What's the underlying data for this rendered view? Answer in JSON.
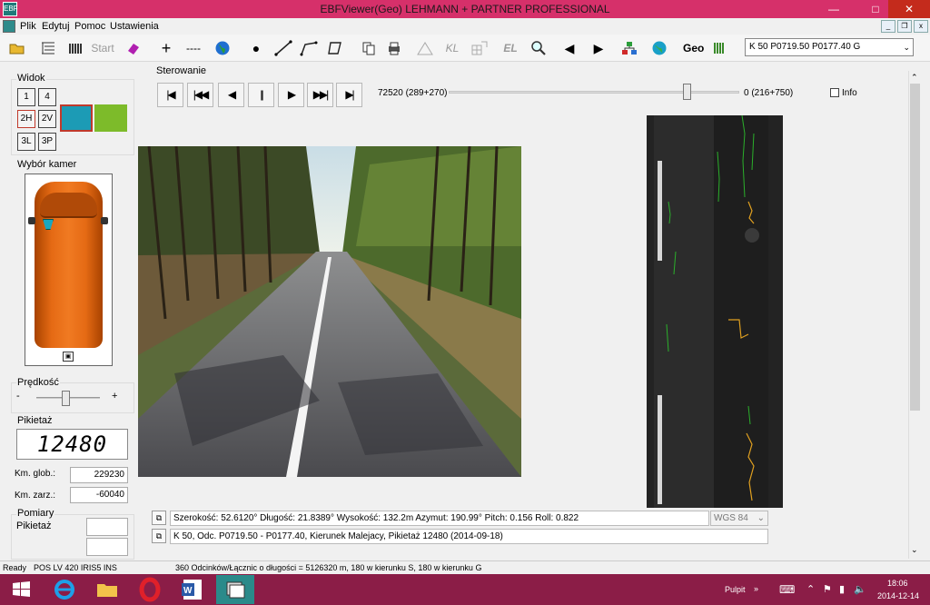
{
  "window": {
    "title": "EBFViewer(Geo) LEHMANN + PARTNER PROFESSIONAL",
    "icon_label": "EBF",
    "controls": [
      "minimize-icon",
      "maximize-icon",
      "close-icon"
    ]
  },
  "menu": {
    "items": [
      "Plik",
      "Edytuj",
      "Pomoc",
      "Ustawienia"
    ]
  },
  "toolbar": {
    "start_label": "Start",
    "dashes_label": "----",
    "kl_label": "KL",
    "el_label": "EL",
    "geo_label": "Geo",
    "layer_select_value": "K 50 P0719.50 P0177.40 G"
  },
  "widok": {
    "label": "Widok",
    "buttons": [
      "1",
      "4",
      "2H",
      "2V",
      "3L",
      "3P"
    ],
    "swatch_colors": [
      "#1c9bb5",
      "#7dbb2a"
    ]
  },
  "camera": {
    "label": "Wybór kamer",
    "van_color": "#e56a14"
  },
  "speed": {
    "label": "Prędkość",
    "minus": "-",
    "plus": "+",
    "level": 0.45
  },
  "pikietaz": {
    "label": "Pikietaż",
    "value": "12480",
    "km_glob_label": "Km. glob.:",
    "km_glob_value": "229230",
    "km_zarz_label": "Km. zarz.:",
    "km_zarz_value": "-60040"
  },
  "pomiary": {
    "label": "Pomiary",
    "pikietaz_label": "Pikietaż"
  },
  "sterowanie": {
    "label": "Sterowanie",
    "position_left": "72520 (289+270)",
    "position_right": "0 (216+750)",
    "slider_level": 0.82,
    "info_label": "Info"
  },
  "info_rows": {
    "coords": "Szerokość: 52.6120°    Długość: 21.8389°    Wysokość: 132.2m    Azymut: 190.99° Pitch: 0.156 Roll: 0.822",
    "crs": "WGS 84",
    "segment": "K 50, Odc. P0719.50 - P0177.40, Kierunek Malejacy, Pikietaż 12480 (2014-09-18)"
  },
  "status": {
    "ready": "Ready",
    "device": "POS LV 420 IRIS5 INS",
    "summary": "360 Odcinków/Łącznic o długości = 5126320 m, 180 w kierunku S, 180 w kierunku G"
  },
  "taskbar": {
    "pulpit": "Pulpit",
    "time": "18:06",
    "date": "2014-12-14"
  }
}
